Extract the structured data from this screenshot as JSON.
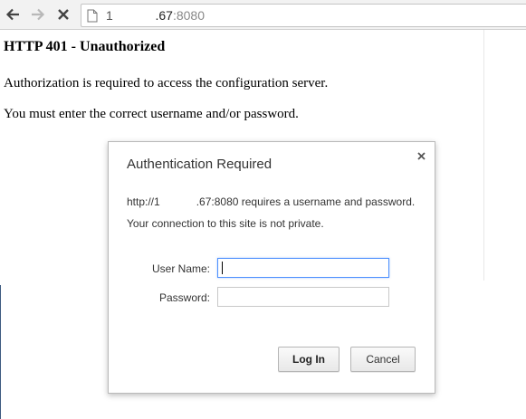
{
  "browser": {
    "url_prefix": "1",
    "url_host": ".67",
    "url_port": ":8080"
  },
  "page": {
    "heading": "HTTP 401 - Unauthorized",
    "paragraph1": "Authorization is required to access the configuration server.",
    "paragraph2": "You must enter the correct username and/or password."
  },
  "dialog": {
    "title": "Authentication Required",
    "message_prefix": "http://1",
    "message_suffix": ".67:8080 requires a username and password.",
    "connection_note": "Your connection to this site is not private.",
    "username_label": "User Name:",
    "username_value": "",
    "password_label": "Password:",
    "password_value": "",
    "login_button": "Log In",
    "cancel_button": "Cancel"
  },
  "icons": {
    "back": "back-arrow-icon",
    "forward": "forward-arrow-icon",
    "stop": "close-icon",
    "page": "page-icon",
    "dialog_close": "close-icon"
  },
  "colors": {
    "focus_border": "#4d90fe",
    "toolbar_bg": "#f2f2f2"
  }
}
